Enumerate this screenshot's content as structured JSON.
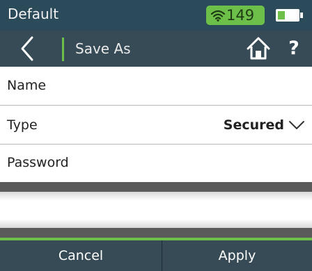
{
  "status_bar": {
    "title": "Default",
    "wifi_count": "149",
    "accent_color": "#6cc04a"
  },
  "nav_bar": {
    "title": "Save As",
    "icons": [
      "back-chevron-icon",
      "home-icon",
      "help-icon"
    ],
    "help_label": "?"
  },
  "form": {
    "name_label": "Name",
    "type_label": "Type",
    "type_value": "Secured",
    "password_label": "Password",
    "input_value": ""
  },
  "footer": {
    "cancel_label": "Cancel",
    "apply_label": "Apply"
  }
}
